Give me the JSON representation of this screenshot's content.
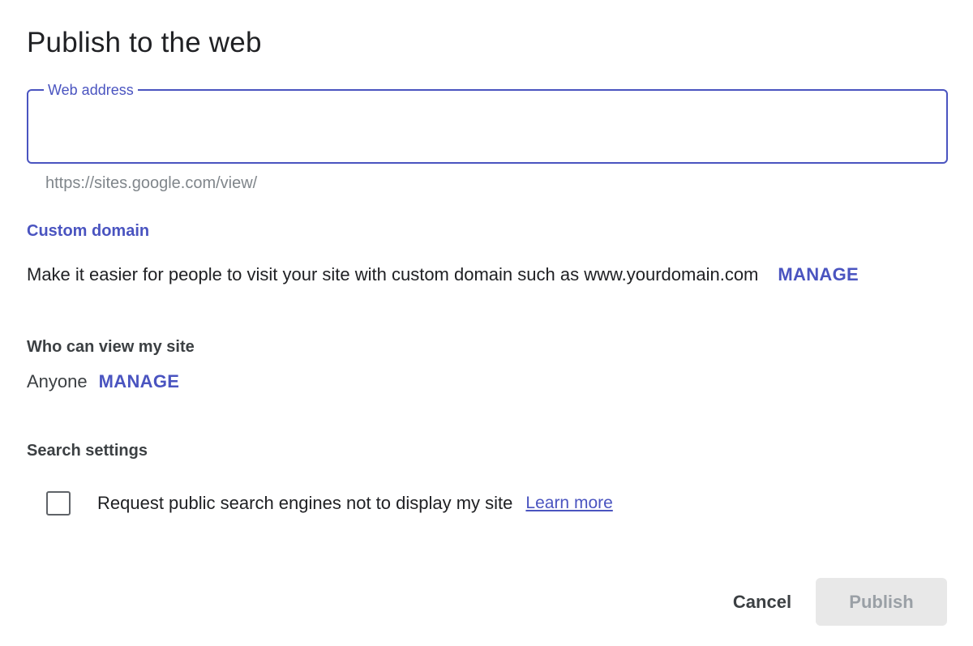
{
  "dialog": {
    "title": "Publish to the web"
  },
  "web_address": {
    "label": "Web address",
    "value": "",
    "helper": "https://sites.google.com/view/"
  },
  "custom_domain": {
    "heading": "Custom domain",
    "description": "Make it easier for people to visit your site with custom domain such as www.yourdomain.com",
    "manage_label": "MANAGE"
  },
  "viewers": {
    "heading": "Who can view my site",
    "value": "Anyone",
    "manage_label": "MANAGE"
  },
  "search_settings": {
    "heading": "Search settings",
    "checkbox_label": "Request public search engines not to display my site",
    "checked": false,
    "learn_more": "Learn more"
  },
  "actions": {
    "cancel": "Cancel",
    "publish": "Publish"
  },
  "colors": {
    "accent": "#4a54c0",
    "publish_disabled_bg": "#e8e8e8",
    "publish_disabled_text": "#9aa0a6"
  }
}
